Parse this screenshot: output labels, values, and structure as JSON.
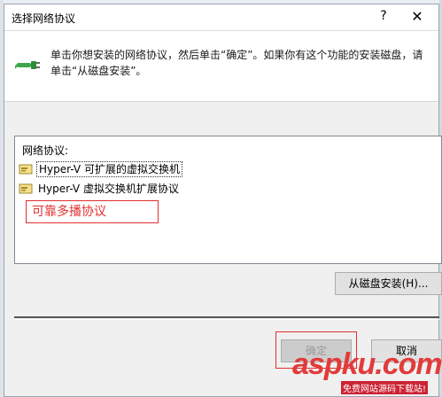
{
  "window": {
    "title": "选择网络协议",
    "help_glyph": "?",
    "close_glyph": "✕"
  },
  "header": {
    "description": "单击你想安装的网络协议，然后单击“确定”。如果你有这个功能的安装磁盘，请单击“从磁盘安装”。",
    "icon": "network-plug-icon"
  },
  "list": {
    "category": "网络协议:",
    "items": [
      {
        "label": "Hyper-V 可扩展的虚拟交换机",
        "icon": "protocol-icon",
        "selected": true
      },
      {
        "label": "Hyper-V 虚拟交换机扩展协议",
        "icon": "protocol-icon",
        "selected": false
      }
    ],
    "annotation": "可靠多播协议"
  },
  "buttons": {
    "have_disk": "从磁盘安装(H)...",
    "ok": "确定",
    "cancel": "取消"
  },
  "watermark": {
    "brand": "aspku.com",
    "tagline": "免费网站源码下载站!"
  },
  "colors": {
    "annotation": "#e03030",
    "icon_green": "#3aa84a"
  }
}
